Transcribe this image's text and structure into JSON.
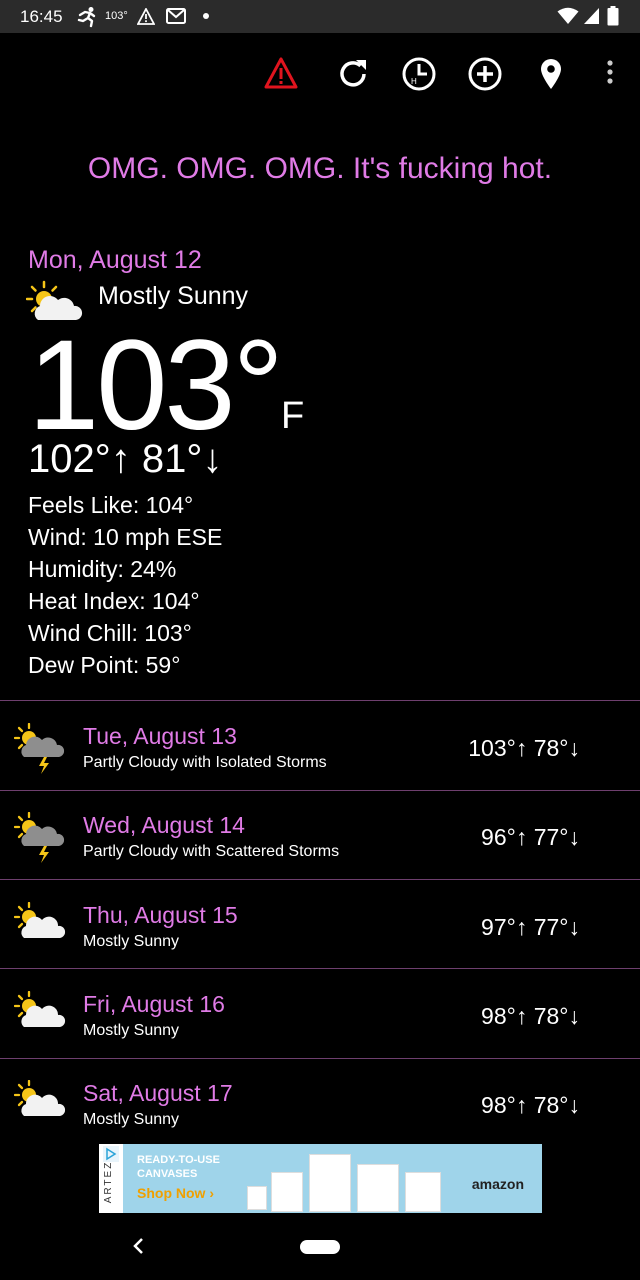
{
  "status_bar": {
    "time": "16:45",
    "temp_badge": "103°"
  },
  "toolbar": {
    "icons": [
      "warning-icon",
      "refresh-icon",
      "history-clock-icon",
      "add-location-icon",
      "location-pin-icon",
      "overflow-menu-icon"
    ],
    "warning_color": "#e0141e"
  },
  "tagline": "OMG. OMG. OMG. It's fucking hot.",
  "today": {
    "date": "Mon, August 12",
    "condition": "Mostly Sunny",
    "temperature": "103°",
    "unit": "F",
    "hilo": "102°↑ 81°↓",
    "details": [
      "Feels Like: 104°",
      "Wind: 10 mph ESE",
      "Humidity: 24%",
      "Heat Index: 104°",
      "Wind Chill: 103°",
      "Dew Point: 59°"
    ]
  },
  "forecast": [
    {
      "date": "Tue, August 13",
      "condition": "Partly Cloudy with Isolated Storms",
      "hilo": "103°↑ 78°↓",
      "icon": "storm"
    },
    {
      "date": "Wed, August 14",
      "condition": "Partly Cloudy with Scattered Storms",
      "hilo": "96°↑ 77°↓",
      "icon": "storm"
    },
    {
      "date": "Thu, August 15",
      "condition": "Mostly Sunny",
      "hilo": "97°↑ 77°↓",
      "icon": "sunny"
    },
    {
      "date": "Fri, August 16",
      "condition": "Mostly Sunny",
      "hilo": "98°↑ 78°↓",
      "icon": "sunny"
    },
    {
      "date": "Sat, August 17",
      "condition": "Mostly Sunny",
      "hilo": "98°↑ 78°↓",
      "icon": "sunny"
    }
  ],
  "ad": {
    "side_text": "ARTEZA",
    "line1": "READY-TO-USE",
    "line2": "CANVASES",
    "cta": "Shop Now ›",
    "brand": "amazon"
  },
  "colors": {
    "accent": "#e07be6",
    "divider": "#6e3f6e",
    "background": "#000000"
  }
}
